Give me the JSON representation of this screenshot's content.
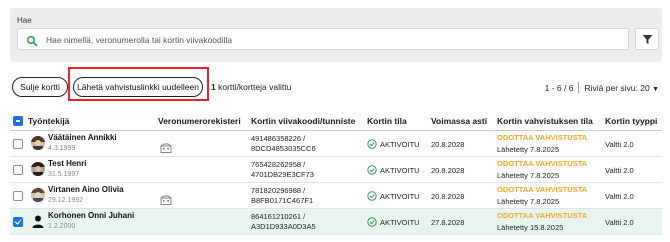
{
  "search": {
    "label": "Hae",
    "placeholder": "Hae nimellä, veronumerolla tai kortin viivakoodilla"
  },
  "toolbar": {
    "close_label": "Sulje kortti",
    "resend_label": "Lähetä vahvistuslinkki uudelleen",
    "selected_count": "1",
    "selected_text": " kortti/kortteja valittu"
  },
  "pager": {
    "range": "1 - 6 / 6",
    "rows_per_page_label": "Riviä per sivu: 20"
  },
  "table": {
    "headers": {
      "employee": "Työntekijä",
      "tax_register": "Veronumerorekisteri",
      "card_id": "Kortin viivakoodi/tunniste",
      "card_status": "Kortin tila",
      "valid_until": "Voimassa asti",
      "verification_status": "Kortin vahvistuksen tila",
      "card_type": "Kortin tyyppi"
    },
    "rows": [
      {
        "name": "Väätäinen Annikki",
        "dob": "4.3.1999",
        "card_id_line1": "491486358226 /",
        "card_id_line2": "8DCD4853035CC6",
        "status": "AKTIVOITU",
        "valid_until": "20.8.2028",
        "verification": "ODOTTAA VAHVISTUSTA",
        "sent": "Lähetetty 7.8.2025",
        "type": "Valtti 2.0"
      },
      {
        "name": "Test Henri",
        "dob": "31.5.1997",
        "card_id_line1": "765428262958 /",
        "card_id_line2": "4701DB29E3CF73",
        "status": "AKTIVOITU",
        "valid_until": "20.8.2028",
        "verification": "ODOTTAA VAHVISTUSTA",
        "sent": "Lähetetty 7.8.2025",
        "type": "Valtti 2.0"
      },
      {
        "name": "Virtanen Aino Olivia",
        "dob": "29.12.1992",
        "card_id_line1": "781820296988 /",
        "card_id_line2": "B8FB0171C467F1",
        "status": "AKTIVOITU",
        "valid_until": "20.8.2028",
        "verification": "ODOTTAA VAHVISTUSTA",
        "sent": "Lähetetty 7.8.2025",
        "type": "Valtti 2.0"
      },
      {
        "name": "Korhonen Onni Juhani",
        "dob": "1.2.2000",
        "card_id_line1": "864161210261 /",
        "card_id_line2": "A3D1D933A0D3A5",
        "status": "AKTIVOITU",
        "valid_until": "27.8.2028",
        "verification": "ODOTTAA VAHVISTUSTA",
        "sent": "Lähetetty 15.8.2025",
        "type": "Valtti 2.0"
      }
    ]
  },
  "colors": {
    "accent_blue": "#1e74d6",
    "highlight_red": "#e0262b",
    "pending_orange": "#f4a62a",
    "active_green": "#2e9b4f",
    "selected_row": "#e8f5ef"
  },
  "icons": {
    "search": "search-icon",
    "filter": "filter-icon",
    "register": "building-icon",
    "status_ok": "check-circle-icon",
    "avatar": "avatar-icon"
  }
}
